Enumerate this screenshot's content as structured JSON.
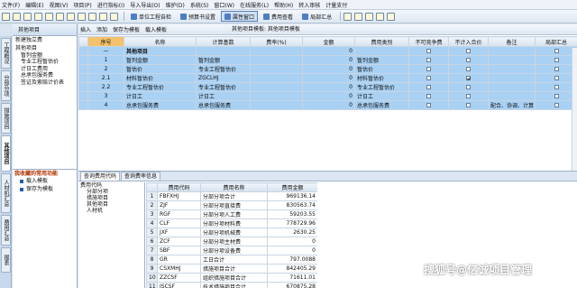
{
  "menu": [
    "文件(F)",
    "编辑(E)",
    "视图(V)",
    "项目(P)",
    "进行指标(I)",
    "导入导出(O)",
    "维护(D)",
    "系统(S)",
    "窗口(W)",
    "在线服务(L)",
    "帮助(H)",
    "转入审核",
    "计量支付"
  ],
  "toolbar": {
    "btn_unit_project": "单位工程自检",
    "btn_fee_check": "预算书设置",
    "btn_attr_window": "属性窗口",
    "btn_fee_view": "费用查看",
    "btn_summary": "局部汇总"
  },
  "nav": {
    "title": "其他项目",
    "root_label": "新建独立费",
    "tree": [
      "其他项目",
      "暂列金额",
      "专业工程暂估价",
      "计日工费用",
      "总承包服务费",
      "签证及索赔计价表"
    ],
    "common_title": "我收藏的常用功能",
    "common_items": [
      "载入模板",
      "保存为模板"
    ]
  },
  "left_tabs": [
    "工程概况",
    "分部分项",
    "措施项目",
    "其他项目",
    "人材机汇总",
    "费用汇总",
    "报表"
  ],
  "subbar": {
    "insert": "插入",
    "add": "添加",
    "save_template": "保存为模板",
    "load_template": "载入模板",
    "breadcrumb": "其他项目模板: 其他项目模板"
  },
  "grid": {
    "headers": [
      "序号",
      "名称",
      "计算基数",
      "费率(%)",
      "金额",
      "费用类别",
      "不可竞争费",
      "不计入合价",
      "备注",
      "局部汇总"
    ],
    "rows": [
      {
        "seq": "—",
        "name": "其他项目",
        "base": "",
        "rate": "",
        "amount": "0",
        "category": "",
        "nc": false,
        "nj": false,
        "note": "",
        "local": false,
        "header": true
      },
      {
        "seq": "1",
        "name": "暂列金额",
        "base": "暂列金额",
        "rate": "",
        "amount": "0",
        "category": "暂列金额",
        "nc": false,
        "nj": false,
        "note": "",
        "local": false
      },
      {
        "seq": "2",
        "name": "暂估价",
        "base": "专业工程暂估价",
        "rate": "",
        "amount": "0",
        "category": "暂估价",
        "nc": false,
        "nj": false,
        "note": "",
        "local": false
      },
      {
        "seq": "2.1",
        "name": "材料暂估价",
        "base": "ZGCLHJ",
        "rate": "",
        "amount": "0",
        "category": "材料暂估价",
        "nc": false,
        "nj": true,
        "note": "",
        "local": false
      },
      {
        "seq": "2.2",
        "name": "专业工程暂估价",
        "base": "专业工程暂估价",
        "rate": "",
        "amount": "0",
        "category": "专业工程暂估价",
        "nc": false,
        "nj": false,
        "note": "",
        "local": false
      },
      {
        "seq": "3",
        "name": "计日工",
        "base": "计日工",
        "rate": "",
        "amount": "0",
        "category": "计日工",
        "nc": false,
        "nj": false,
        "note": "",
        "local": false
      },
      {
        "seq": "4",
        "name": "总承包服务费",
        "base": "总承包服务费",
        "rate": "",
        "amount": "0",
        "category": "总承包服务费",
        "nc": false,
        "nj": false,
        "note": "配合、协调、计算",
        "local": false
      }
    ]
  },
  "bottom_tabs": [
    "查询费用代码",
    "查询费率信息"
  ],
  "bottom_tree": [
    "费用代码",
    "分部分项",
    "措施项目",
    "其他项目",
    "人材机"
  ],
  "codes": {
    "headers": [
      "",
      "费用代码",
      "费用名称",
      "费用金额"
    ],
    "rows": [
      {
        "n": "1",
        "code": "FBFXHJ",
        "name": "分部分项合计",
        "amount": "969136.14"
      },
      {
        "n": "2",
        "code": "ZJF",
        "name": "分部分项直接费",
        "amount": "830563.74"
      },
      {
        "n": "3",
        "code": "RGF",
        "name": "分部分项人工费",
        "amount": "59203.55"
      },
      {
        "n": "4",
        "code": "CLF",
        "name": "分部分项材料费",
        "amount": "778729.96"
      },
      {
        "n": "5",
        "code": "JXF",
        "name": "分部分项机械费",
        "amount": "2630.25"
      },
      {
        "n": "6",
        "code": "ZCF",
        "name": "分部分项主材费",
        "amount": "0"
      },
      {
        "n": "7",
        "code": "SBF",
        "name": "分部分项设备费",
        "amount": "0"
      },
      {
        "n": "8",
        "code": "GR",
        "name": "工日合计",
        "amount": "797.0088"
      },
      {
        "n": "9",
        "code": "CSXMHJ",
        "name": "措施项目合计",
        "amount": "842405.29"
      },
      {
        "n": "10",
        "code": "ZZCSF",
        "name": "组织措施项目合计",
        "amount": "71611.01"
      },
      {
        "n": "11",
        "code": "JSCSF",
        "name": "技术措施项目合计",
        "amount": "670875.28"
      }
    ]
  },
  "watermark": "搜狐号@亿诚项目管理"
}
